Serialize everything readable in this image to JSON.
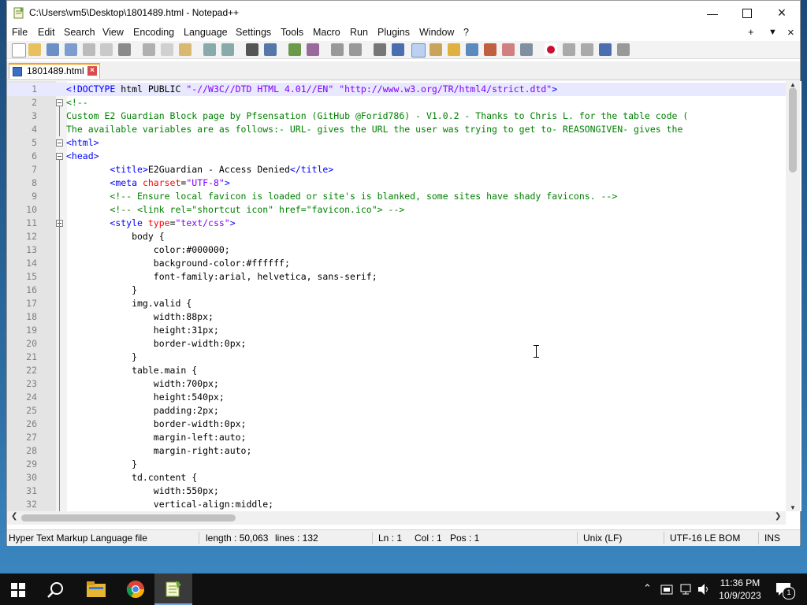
{
  "window": {
    "title": "C:\\Users\\vm5\\Desktop\\1801489.html - Notepad++"
  },
  "menu": {
    "items": [
      "File",
      "Edit",
      "Search",
      "View",
      "Encoding",
      "Language",
      "Settings",
      "Tools",
      "Macro",
      "Run",
      "Plugins",
      "Window",
      "?"
    ]
  },
  "tabs": [
    {
      "label": "1801489.html"
    }
  ],
  "editor": {
    "lines": [
      {
        "n": "1",
        "t": "<!DOCTYPE html PUBLIC \"-//W3C//DTD HTML 4.01//EN\" \"http://www.w3.org/TR/html4/strict.dtd\">"
      },
      {
        "n": "2",
        "t": "<!--"
      },
      {
        "n": "3",
        "t": "Custom E2 Guardian Block page by Pfsensation (GitHub @Forid786) - V1.0.2 - Thanks to Chris L. for the table code ("
      },
      {
        "n": "4",
        "t": "The available variables are as follows:- URL- gives the URL the user was trying to get to- REASONGIVEN- gives the"
      },
      {
        "n": "5",
        "t": "<html>"
      },
      {
        "n": "6",
        "t": "<head>"
      },
      {
        "n": "7",
        "t": "        <title>E2Guardian - Access Denied</title>"
      },
      {
        "n": "8",
        "t": "        <meta charset=\"UTF-8\">"
      },
      {
        "n": "9",
        "t": "        <!-- Ensure local favicon is loaded or site's is blanked, some sites have shady favicons. -->"
      },
      {
        "n": "10",
        "t": "        <!-- <link rel=\"shortcut icon\" href=\"favicon.ico\"> -->"
      },
      {
        "n": "11",
        "t": "        <style type=\"text/css\">"
      },
      {
        "n": "12",
        "t": "            body {"
      },
      {
        "n": "13",
        "t": "                color:#000000;"
      },
      {
        "n": "14",
        "t": "                background-color:#ffffff;"
      },
      {
        "n": "15",
        "t": "                font-family:arial, helvetica, sans-serif;"
      },
      {
        "n": "16",
        "t": "            }"
      },
      {
        "n": "17",
        "t": "            img.valid {"
      },
      {
        "n": "18",
        "t": "                width:88px;"
      },
      {
        "n": "19",
        "t": "                height:31px;"
      },
      {
        "n": "20",
        "t": "                border-width:0px;"
      },
      {
        "n": "21",
        "t": "            }"
      },
      {
        "n": "22",
        "t": "            table.main {"
      },
      {
        "n": "23",
        "t": "                width:700px;"
      },
      {
        "n": "24",
        "t": "                height:540px;"
      },
      {
        "n": "25",
        "t": "                padding:2px;"
      },
      {
        "n": "26",
        "t": "                border-width:0px;"
      },
      {
        "n": "27",
        "t": "                margin-left:auto;"
      },
      {
        "n": "28",
        "t": "                margin-right:auto;"
      },
      {
        "n": "29",
        "t": "            }"
      },
      {
        "n": "30",
        "t": "            td.content {"
      },
      {
        "n": "31",
        "t": "                width:550px;"
      },
      {
        "n": "32",
        "t": "                vertical-align:middle;"
      }
    ]
  },
  "status": {
    "filetype": "Hyper Text Markup Language file",
    "length": "length : 50,063",
    "lines": "lines : 132",
    "ln": "Ln : 1",
    "col": "Col : 1",
    "pos": "Pos : 1",
    "eol": "Unix (LF)",
    "encoding": "UTF-16 LE BOM",
    "mode": "INS"
  },
  "taskbar": {
    "time": "11:36 PM",
    "date": "10/9/2023",
    "notifications": "1"
  },
  "colors": {
    "accent_tab": "#f6a11a",
    "tag": "#0000ff",
    "attr": "#ff0000",
    "value": "#8000ff",
    "comment": "#008000"
  }
}
